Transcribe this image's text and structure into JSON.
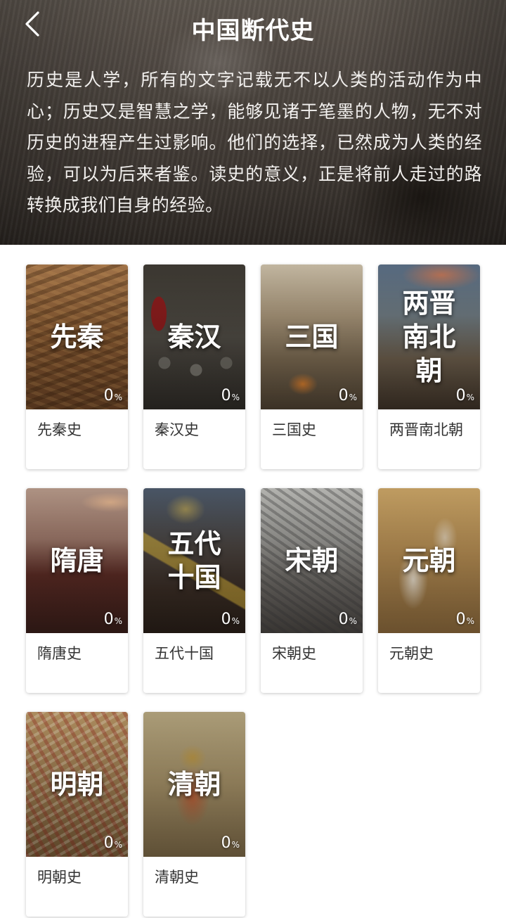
{
  "header": {
    "title": "中国断代史",
    "intro": "历史是人学，所有的文字记载无不以人类的活动作为中心；历史又是智慧之学，能够见诸于笔墨的人物，无不对历史的进程产生过影响。他们的选择，已然成为人类的经验，可以为后来者鉴。读史的意义，正是将前人走过的路转换成我们自身的经验。",
    "back_icon": "chevron-left-icon"
  },
  "courses": [
    {
      "cover_title": "先秦",
      "progress": "0",
      "unit": "%",
      "label": "先秦史"
    },
    {
      "cover_title": "秦汉",
      "progress": "0",
      "unit": "%",
      "label": "秦汉史"
    },
    {
      "cover_title": "三国",
      "progress": "0",
      "unit": "%",
      "label": "三国史"
    },
    {
      "cover_title": "两晋南北朝",
      "progress": "0",
      "unit": "%",
      "label": "两晋南北朝"
    },
    {
      "cover_title": "隋唐",
      "progress": "0",
      "unit": "%",
      "label": "隋唐史"
    },
    {
      "cover_title": "五代十国",
      "progress": "0",
      "unit": "%",
      "label": "五代十国"
    },
    {
      "cover_title": "宋朝",
      "progress": "0",
      "unit": "%",
      "label": "宋朝史"
    },
    {
      "cover_title": "元朝",
      "progress": "0",
      "unit": "%",
      "label": "元朝史"
    },
    {
      "cover_title": "明朝",
      "progress": "0",
      "unit": "%",
      "label": "明朝史"
    },
    {
      "cover_title": "清朝",
      "progress": "0",
      "unit": "%",
      "label": "清朝史"
    }
  ]
}
